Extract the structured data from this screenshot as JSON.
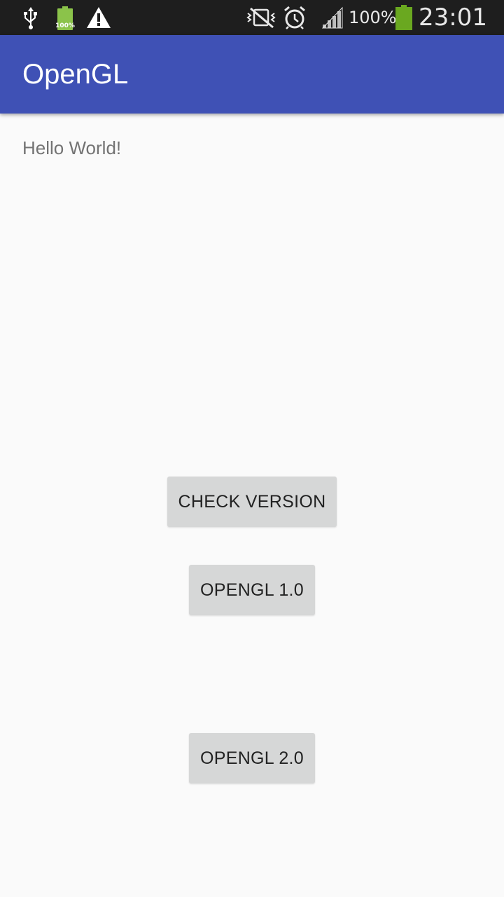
{
  "status_bar": {
    "battery_badge": "100%",
    "battery_percent": "100%",
    "time": "23:01",
    "icons": [
      "usb-icon",
      "battery-charging-icon",
      "warning-icon",
      "mute-icon",
      "alarm-icon",
      "signal-icon",
      "battery-icon"
    ]
  },
  "app_bar": {
    "title": "OpenGL",
    "color": "#3f51b5"
  },
  "main": {
    "greeting": "Hello World!",
    "buttons": {
      "check_version": "CHECK VERSION",
      "opengl_1": "OPENGL 1.0",
      "opengl_2": "OPENGL 2.0"
    }
  }
}
